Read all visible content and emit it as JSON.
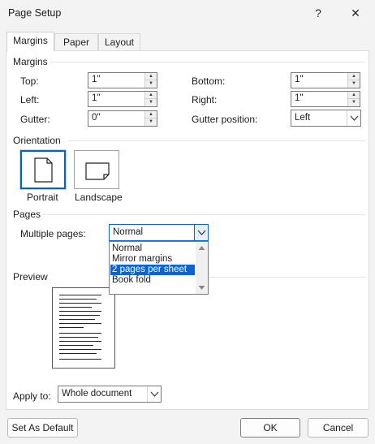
{
  "window": {
    "title": "Page Setup",
    "help_glyph": "?",
    "close_glyph": "✕"
  },
  "tabs": [
    {
      "label": "Margins",
      "active": true
    },
    {
      "label": "Paper",
      "active": false
    },
    {
      "label": "Layout",
      "active": false
    }
  ],
  "margins": {
    "section_title": "Margins",
    "top": {
      "label": "Top:",
      "value": "1\""
    },
    "left": {
      "label": "Left:",
      "value": "1\""
    },
    "gutter": {
      "label": "Gutter:",
      "value": "0\""
    },
    "bottom": {
      "label": "Bottom:",
      "value": "1\""
    },
    "right": {
      "label": "Right:",
      "value": "1\""
    },
    "gutter_position": {
      "label": "Gutter position:",
      "value": "Left"
    }
  },
  "orientation": {
    "section_title": "Orientation",
    "portrait_label": "Portrait",
    "landscape_label": "Landscape",
    "selected": "portrait"
  },
  "pages": {
    "section_title": "Pages",
    "multiple_pages_label": "Multiple pages:",
    "selected_value": "Normal",
    "options": [
      "Normal",
      "Mirror margins",
      "2 pages per sheet",
      "Book fold"
    ],
    "highlighted_option": "2 pages per sheet"
  },
  "preview": {
    "section_title": "Preview"
  },
  "apply_to": {
    "label": "Apply to:",
    "value": "Whole document"
  },
  "footer": {
    "set_default_label": "Set As Default",
    "ok_label": "OK",
    "cancel_label": "Cancel"
  },
  "colors": {
    "accent": "#0a64d6",
    "dialog_bg": "#f3f3f3",
    "panel_bg": "#ffffff"
  }
}
